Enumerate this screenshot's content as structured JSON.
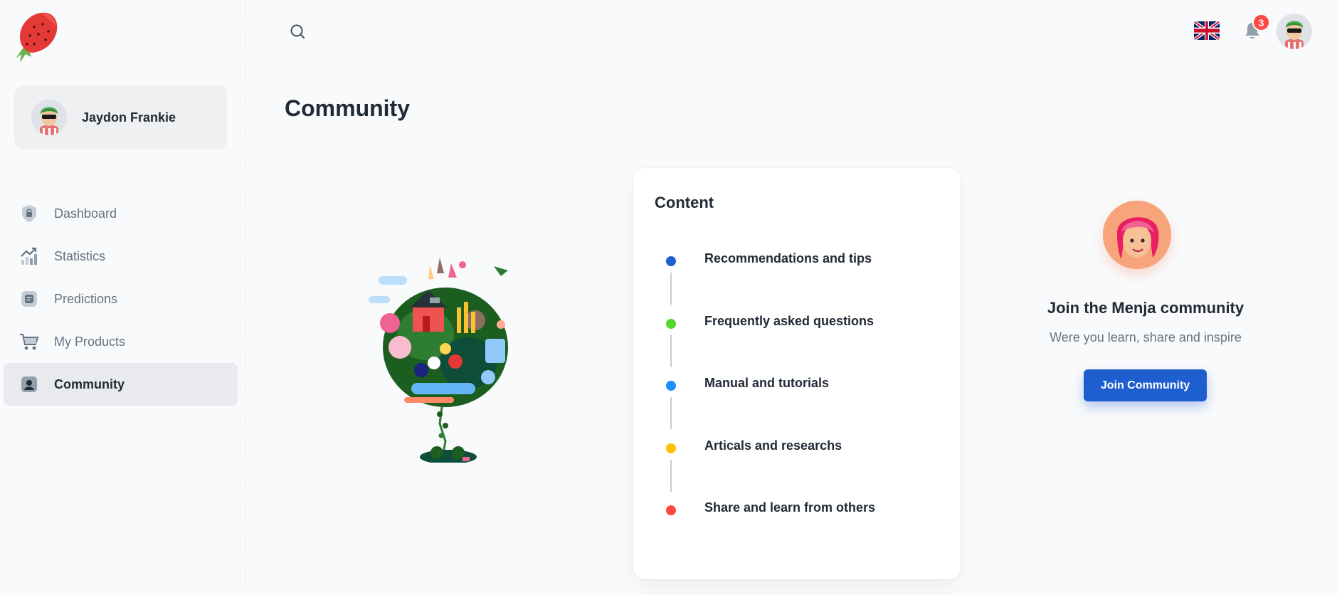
{
  "app": {
    "logo_icon": "strawberry-logo-icon",
    "colors": {
      "accent": "#1e5fd0",
      "badge": "#ff4842",
      "text_primary": "#212b36",
      "text_secondary": "#637381"
    }
  },
  "sidebar": {
    "user": {
      "name": "Jaydon Frankie",
      "avatar_icon": "user-avatar"
    },
    "items": [
      {
        "label": "Dashboard",
        "icon": "shield-lock-icon",
        "active": false
      },
      {
        "label": "Statistics",
        "icon": "chart-trend-icon",
        "active": false
      },
      {
        "label": "Predictions",
        "icon": "document-icon",
        "active": false
      },
      {
        "label": "My Products",
        "icon": "cart-icon",
        "active": false
      },
      {
        "label": "Community",
        "icon": "user-square-icon",
        "active": true
      }
    ]
  },
  "header": {
    "search_icon": "search-icon",
    "language_icon": "uk-flag-icon",
    "notification_icon": "bell-icon",
    "notification_count": "3"
  },
  "main": {
    "title": "Community",
    "content_card": {
      "title": "Content",
      "items": [
        {
          "label": "Recommendations and tips",
          "color": "#1e5fd0"
        },
        {
          "label": "Frequently asked questions",
          "color": "#54d62c"
        },
        {
          "label": "Manual and tutorials",
          "color": "#1890ff"
        },
        {
          "label": "Articals and researchs",
          "color": "#ffc107"
        },
        {
          "label": "Share and learn from others",
          "color": "#ff4842"
        }
      ]
    },
    "promo": {
      "title": "Join the Menja community",
      "subtitle": "Were you learn, share and inspire",
      "button_label": "Join Community"
    }
  }
}
